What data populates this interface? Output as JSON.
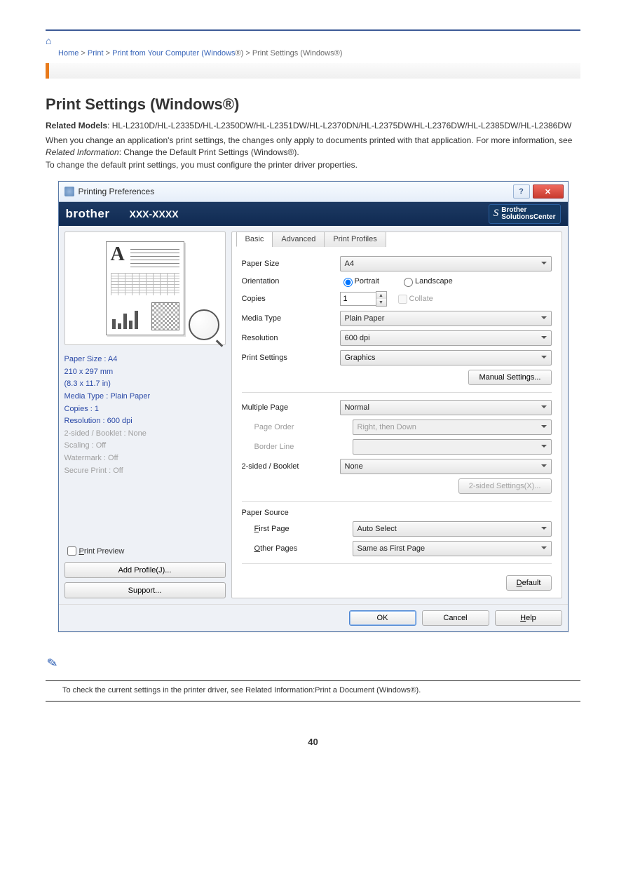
{
  "breadcrumb": {
    "a": "Home",
    "sep1": " > ",
    "b": "Print",
    "sep2": " > ",
    "c": "Print from Your Computer (Windows",
    "reg": "®",
    "end": ") > Print Settings (Windows",
    "end2": ")"
  },
  "kicker": "",
  "page_title": "Print Settings (Windows®)",
  "models_label": "Related Models",
  "models": ": HL-L2310D/HL-L2335D/HL-L2350DW/HL-L2351DW/HL-L2370DN/HL-L2375DW/HL-L2376DW/HL-L2385DW/HL-L2386DW",
  "intro_a": "When you change an application's print settings, the changes only apply to documents printed with that application. For more information, see ",
  "intro_link": "Related Information",
  "intro_b": ": Change the Default Print Settings (Windows®).",
  "intro_c": "To change the default print settings, you must configure the printer driver properties.",
  "dialog": {
    "title": "Printing Preferences",
    "help": "?",
    "close": "✕",
    "brand": "brother",
    "model": "XXX-XXXX",
    "solutions_a": "Brother",
    "solutions_b": "SolutionsCenter",
    "tabs": [
      "Basic",
      "Advanced",
      "Print Profiles"
    ],
    "info": {
      "l1": "Paper Size : A4",
      "l2": "210 x 297 mm",
      "l3": "(8.3 x 11.7 in)",
      "l4": "Media Type : Plain Paper",
      "l5": "Copies : 1",
      "l6": "Resolution : 600 dpi",
      "l7": "2-sided / Booklet : None",
      "l8": "Scaling : Off",
      "l9": "Watermark : Off",
      "l10": "Secure Print : Off"
    },
    "print_preview": "Print Preview",
    "add_profile": "Add Profile(J)...",
    "support": "Support...",
    "labels": {
      "paper_size": "Paper Size",
      "orientation": "Orientation",
      "copies": "Copies",
      "media_type": "Media Type",
      "resolution": "Resolution",
      "print_settings": "Print Settings",
      "manual": "Manual Settings...",
      "multiple_page": "Multiple Page",
      "page_order": "Page Order",
      "border_line": "Border Line",
      "twosided": "2-sided / Booklet",
      "twosided_btn": "2-sided Settings(X)...",
      "paper_source": "Paper Source",
      "first_page": "First Page",
      "other_pages": "Other Pages",
      "default": "Default",
      "ok": "OK",
      "cancel": "Cancel",
      "help": "Help",
      "portrait": "Portrait",
      "landscape": "Landscape",
      "collate": "Collate"
    },
    "values": {
      "paper_size": "A4",
      "copies": "1",
      "media_type": "Plain Paper",
      "resolution": "600 dpi",
      "print_settings": "Graphics",
      "multiple_page": "Normal",
      "page_order": "Right, then Down",
      "border_line": "",
      "twosided": "None",
      "first_page": "Auto Select",
      "other_pages": "Same as First Page"
    }
  },
  "note": "To check the current settings in the printer driver, see Related Information:Print a Document (Windows®).",
  "page_number": "40"
}
